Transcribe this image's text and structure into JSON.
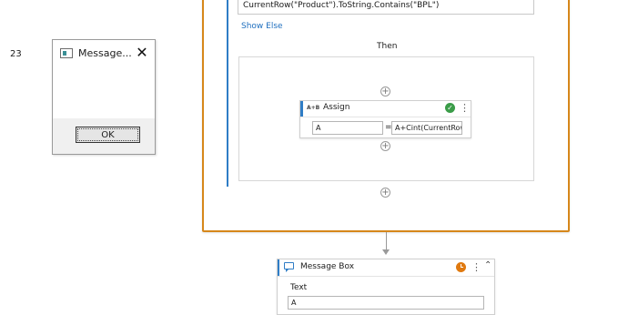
{
  "message_dialog": {
    "title": "Message...",
    "close_glyph": "✕",
    "message": "23",
    "ok_label": "OK",
    "icon": "window-app-icon"
  },
  "if_activity": {
    "condition": "CurrentRow(\"Product\").ToString.Contains(\"BPL\")",
    "show_else_link": "Show Else",
    "then_label": "Then",
    "add_glyph": "+"
  },
  "assign_activity": {
    "icon_text": "A+B",
    "title": "Assign",
    "status_glyph": "✓",
    "menu_glyph": "⋮",
    "to_value": "A",
    "equals": "=",
    "value_expression": "A+Cint(CurrentRow(\"Quantity\"))"
  },
  "message_box_activity": {
    "title": "Message Box",
    "menu_glyph": "⋮",
    "collapse_glyph": "⌃",
    "text_label": "Text",
    "text_value": "A",
    "status_icon": "clock-icon",
    "icon": "message-bubble-icon"
  },
  "colors": {
    "container_border": "#d6871a",
    "activity_accent": "#2f7dc6",
    "success": "#3a9c48",
    "warning": "#e07a10",
    "link": "#1f6fbf"
  }
}
